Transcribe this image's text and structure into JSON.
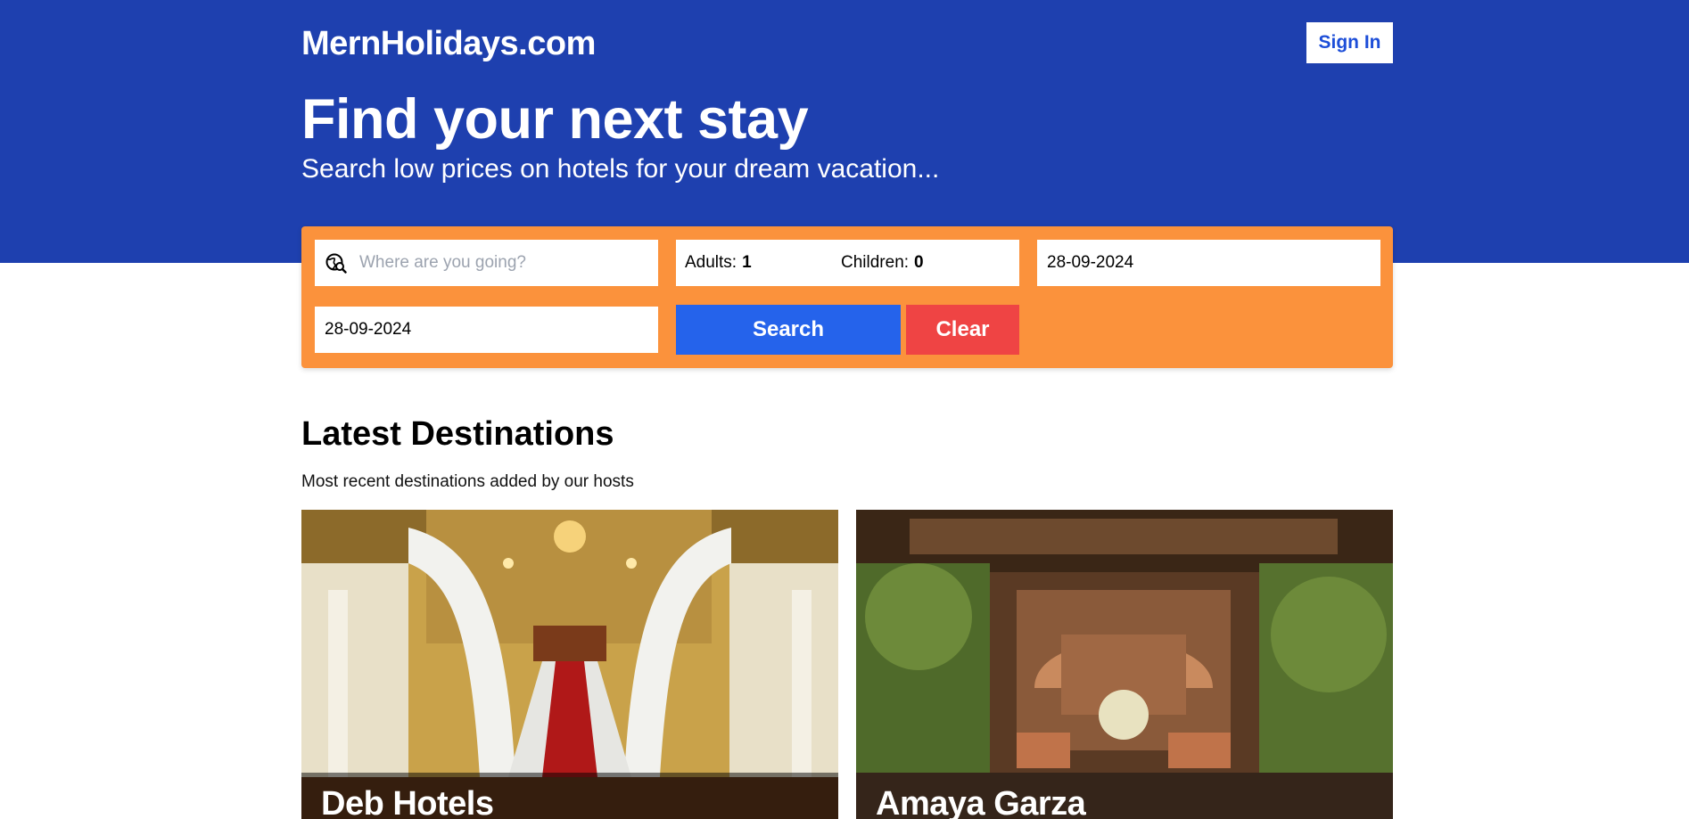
{
  "header": {
    "logo": "MernHolidays.com",
    "signin_label": "Sign In"
  },
  "hero": {
    "title": "Find your next stay",
    "subtitle": "Search low prices on hotels for your dream vacation..."
  },
  "search": {
    "destination_placeholder": "Where are you going?",
    "destination_value": "",
    "adults_label": "Adults:",
    "adults_value": "1",
    "children_label": "Children:",
    "children_value": "0",
    "checkin": "28-09-2024",
    "checkout": "28-09-2024",
    "search_label": "Search",
    "clear_label": "Clear",
    "globe_icon": "globe-search-icon"
  },
  "latest": {
    "title": "Latest Destinations",
    "subtitle": "Most recent destinations added by our hosts",
    "cards": [
      {
        "name": "Deb Hotels"
      },
      {
        "name": "Amaya Garza"
      }
    ]
  },
  "colors": {
    "hero_bg": "#1e40af",
    "searchbar_bg": "#fb923c",
    "search_btn": "#2563eb",
    "clear_btn": "#ef4444"
  }
}
